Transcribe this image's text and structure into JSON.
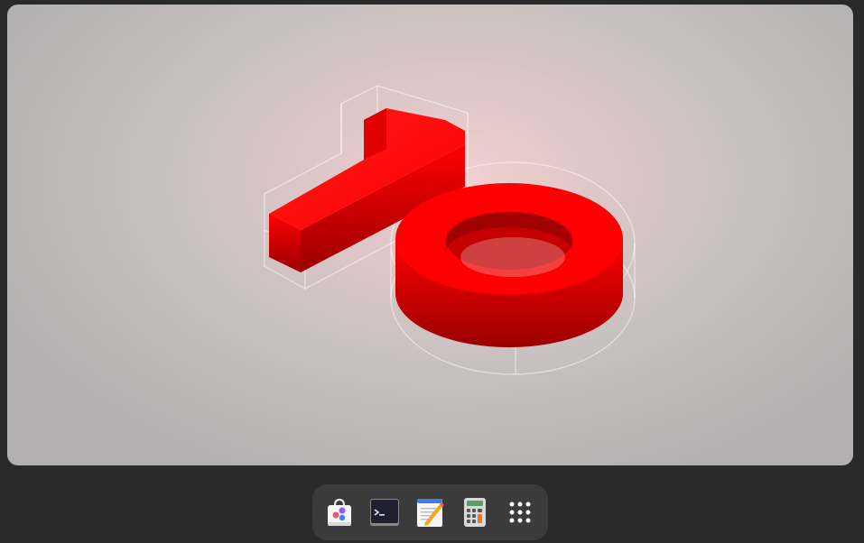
{
  "workspace": {
    "wallpaper": "gnome-10-red-numerals",
    "wallpaper_colors": {
      "numeral": "#ff0000",
      "numeral_shadow": "#a00000",
      "background_center": "#f2cfcf",
      "background_edge": "#b2b0b0"
    }
  },
  "dash": {
    "apps": [
      {
        "id": "software",
        "icon": "software-bag-icon"
      },
      {
        "id": "terminal",
        "icon": "terminal-icon"
      },
      {
        "id": "text-editor",
        "icon": "text-editor-icon"
      },
      {
        "id": "calculator",
        "icon": "calculator-icon"
      }
    ],
    "show_apps": {
      "icon": "show-apps-grid-icon"
    },
    "colors": {
      "dash_bg": "#3b3b3b",
      "desktop_bg": "#2a2a2a"
    }
  }
}
